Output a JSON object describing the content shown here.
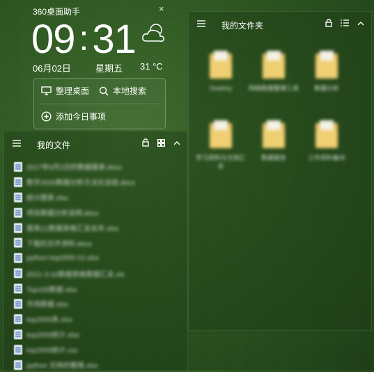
{
  "assistant": {
    "title": "360桌面助手",
    "close_glyph": "×",
    "clock": {
      "hours": "09",
      "sep": ":",
      "minutes": "31"
    },
    "date": "06月02日",
    "weekday": "星期五",
    "temperature": "31 °C",
    "weather_icon": "cloudy-icon",
    "tools": {
      "organize_label": "整理桌面",
      "search_label": "本地搜索",
      "add_event_label": "添加今日事项"
    }
  },
  "files_panel": {
    "title": "我的文件",
    "items": [
      {
        "name": "2017年6月2日的数据报表.docx"
      },
      {
        "name": "数字2020数据分析方法论总结.docx"
      },
      {
        "name": "统计图表.xlsx"
      },
      {
        "name": "项目数据分析说明.docx"
      },
      {
        "name": "报表(1)数据表格汇总合并.xlsx"
      },
      {
        "name": "下载的文件资料.docx"
      },
      {
        "name": "python-top2000-12.xlsx"
      },
      {
        "name": "2021-3-16数据表格数据汇总.xls"
      },
      {
        "name": "Top100数据.xlsx"
      },
      {
        "name": "市场数据.xlsx"
      },
      {
        "name": "top2000表.xlsx"
      },
      {
        "name": "top2000统计.xlsx"
      },
      {
        "name": "top2000统计.csv"
      },
      {
        "name": "python 文档的整理.xlsx"
      }
    ]
  },
  "folder_panel": {
    "title": "我的文件夹",
    "folders": [
      {
        "name": "OneKey"
      },
      {
        "name": "网络数据整理工具"
      },
      {
        "name": "数据分析"
      },
      {
        "name": "学习资料与文档汇总"
      },
      {
        "name": "数据报告"
      },
      {
        "name": "工作资料备份"
      }
    ]
  },
  "colors": {
    "background": "#2f5a22",
    "panel_bg": "rgba(30,60,22,0.45)",
    "folder": "#e7c063"
  }
}
